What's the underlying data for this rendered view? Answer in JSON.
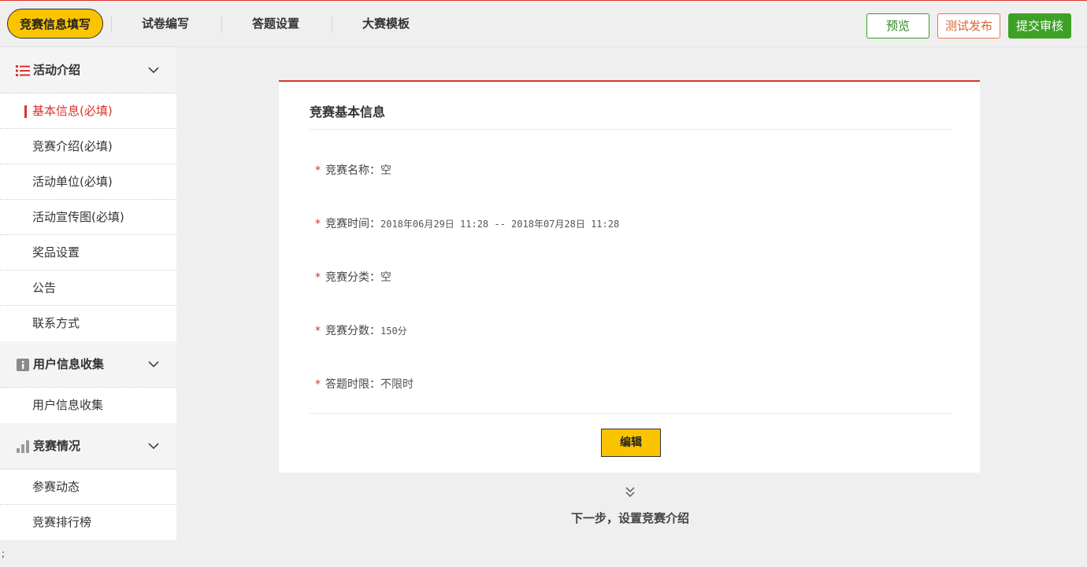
{
  "tabs": [
    {
      "label": "竞赛信息填写",
      "active": true
    },
    {
      "label": "试卷编写"
    },
    {
      "label": "答题设置"
    },
    {
      "label": "大赛模板"
    }
  ],
  "actions": {
    "preview": "预览",
    "test_publish": "测试发布",
    "submit_review": "提交审核"
  },
  "sidebar": {
    "sections": [
      {
        "title": "活动介绍",
        "icon": "list-icon",
        "items": [
          "基本信息(必填)",
          "竞赛介绍(必填)",
          "活动单位(必填)",
          "活动宣传图(必填)",
          "奖品设置",
          "公告",
          "联系方式"
        ]
      },
      {
        "title": "用户信息收集",
        "icon": "info-icon",
        "items": [
          "用户信息收集"
        ]
      },
      {
        "title": "竞赛情况",
        "icon": "bar-chart-icon",
        "items": [
          "参赛动态",
          "竞赛排行榜"
        ]
      }
    ]
  },
  "card": {
    "title": "竞赛基本信息",
    "fields": [
      {
        "label": "竞赛名称：",
        "value": "空"
      },
      {
        "label": "竞赛时间：",
        "value": "2018年06月29日 11:28 -- 2018年07月28日 11:28"
      },
      {
        "label": "竞赛分类：",
        "value": "空"
      },
      {
        "label": "竞赛分数：",
        "value": "150分"
      },
      {
        "label": "答题时限：",
        "value": "不限时"
      }
    ],
    "edit_label": "编辑"
  },
  "next_step": "下一步，设置竞赛介绍",
  "stray_text": ";",
  "colors": {
    "accent_red": "#d9342b",
    "active_yellow": "#fbc400",
    "green": "#3ea126",
    "orange": "#e0612e"
  }
}
